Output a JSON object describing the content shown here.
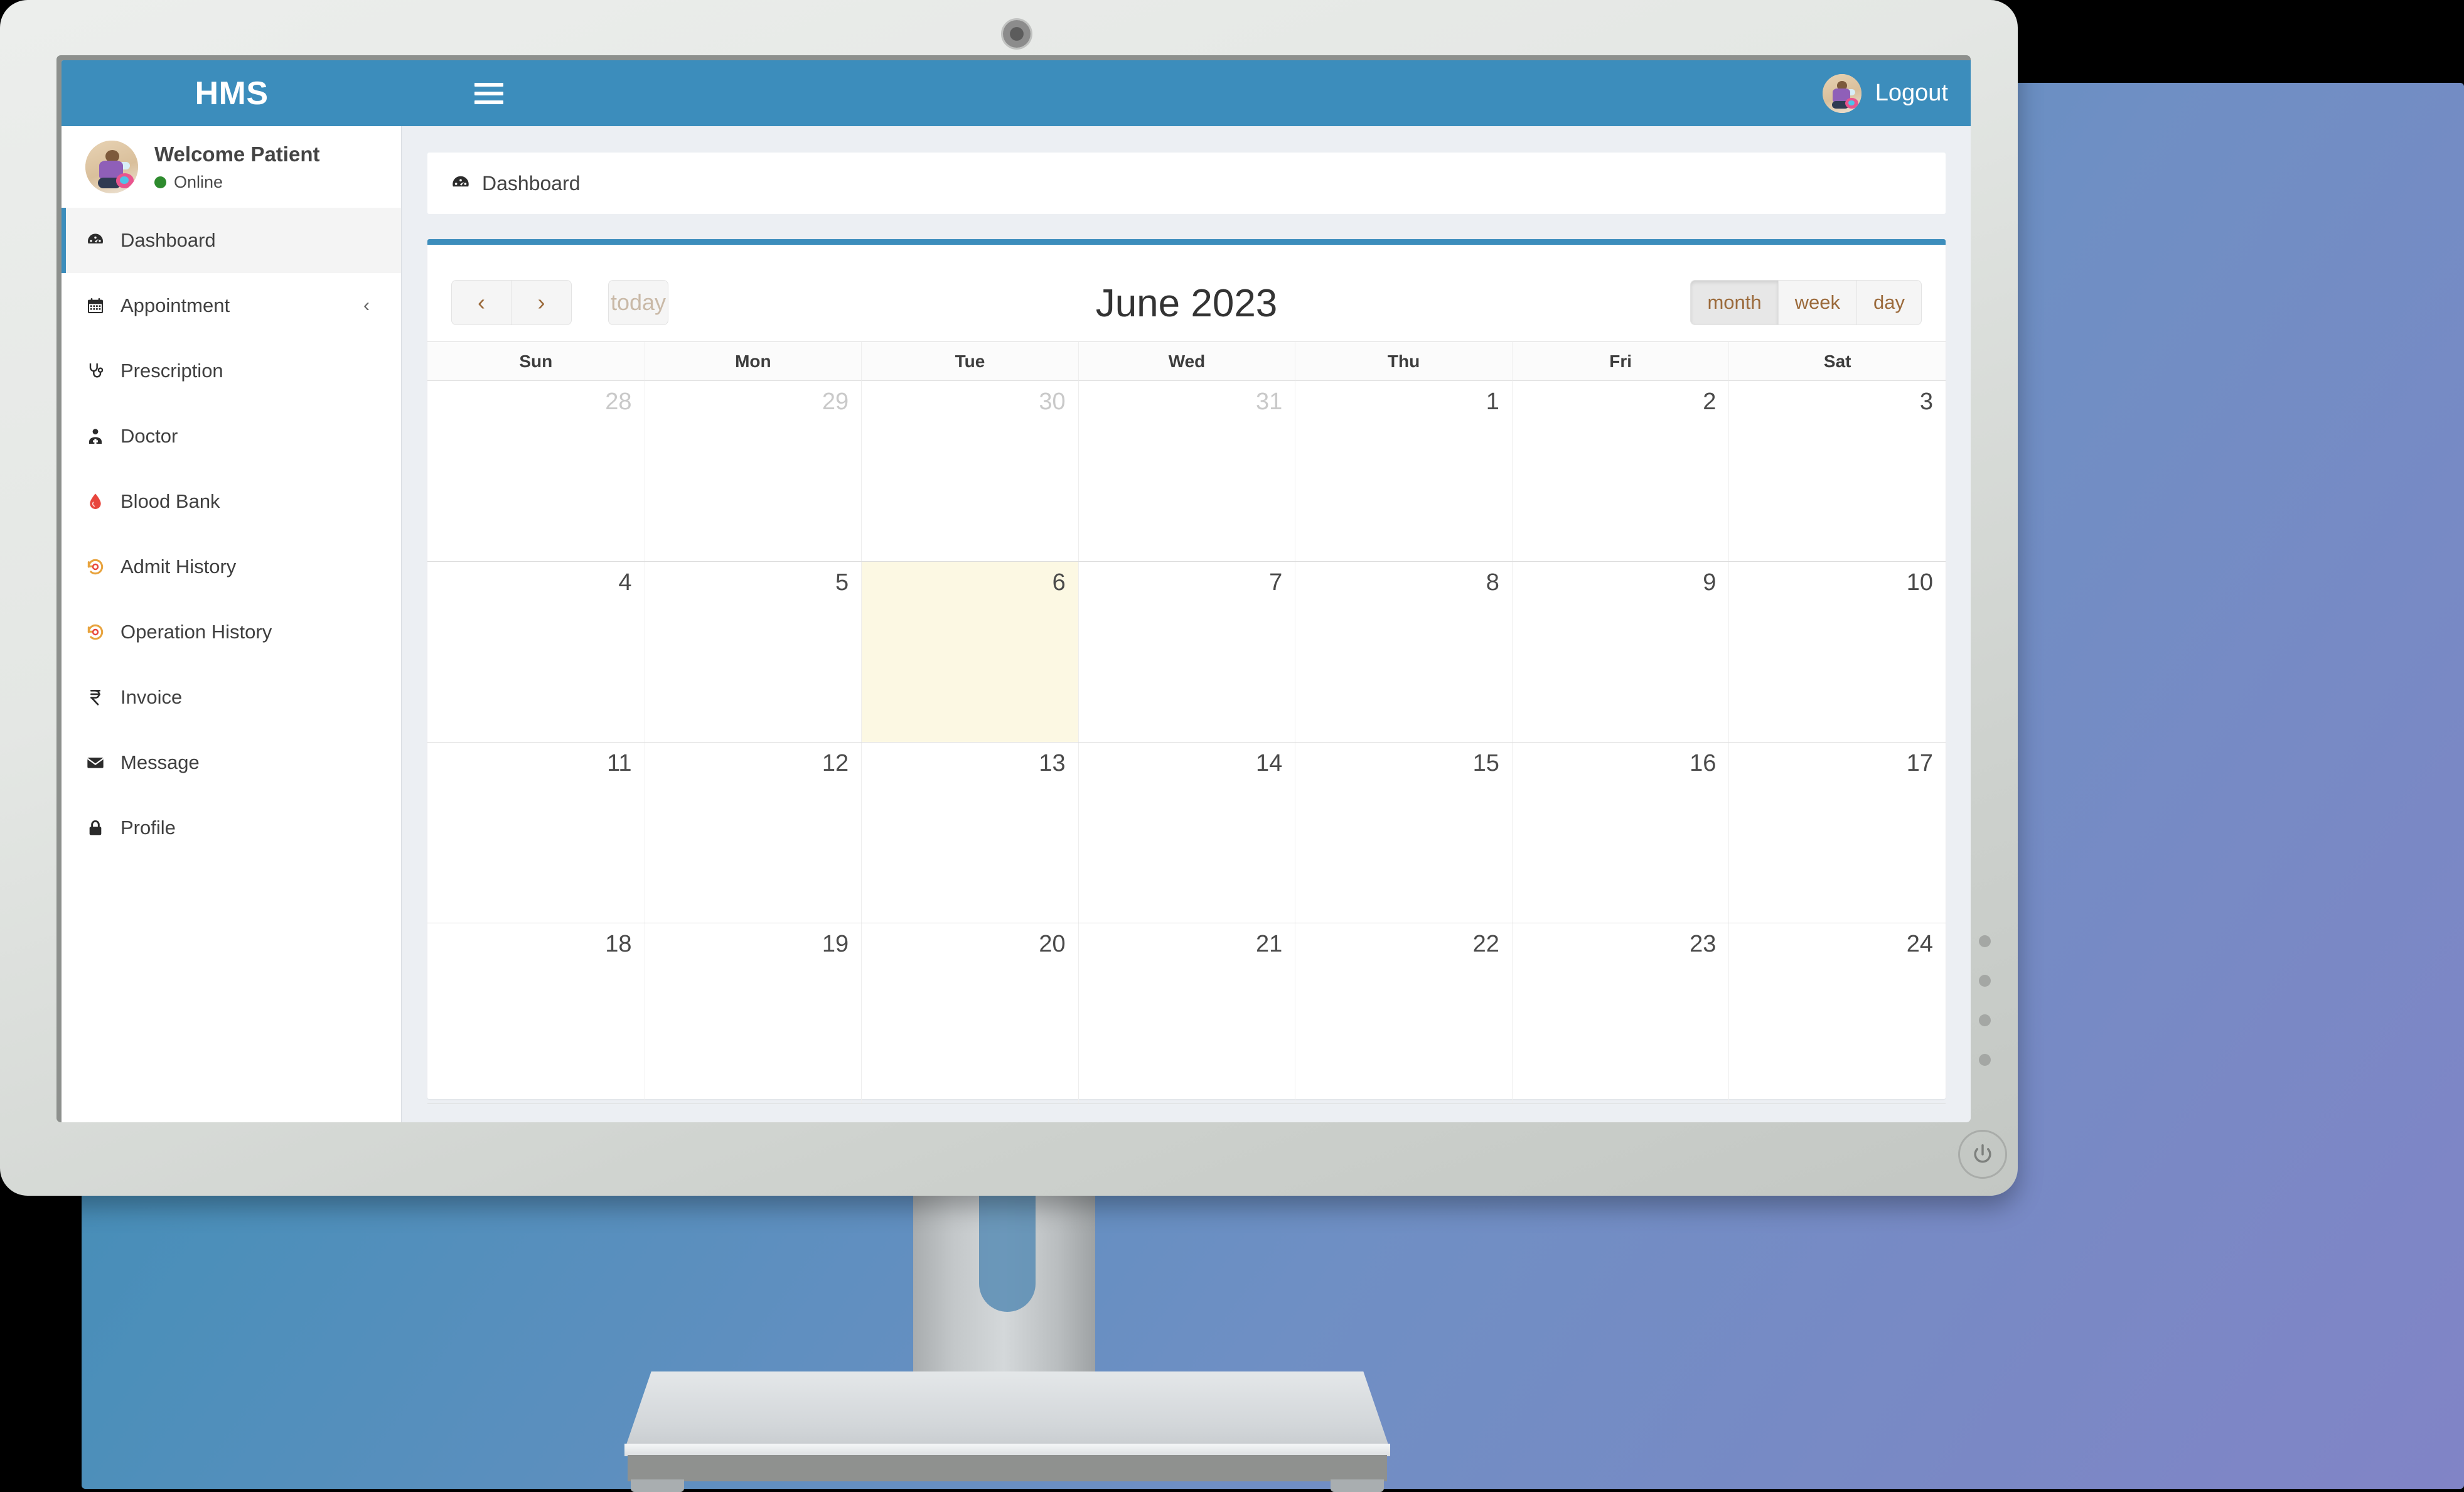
{
  "app": {
    "brand": "HMS",
    "menu_icon": "hamburger-icon",
    "logout_label": "Logout"
  },
  "user": {
    "name": "Welcome Patient",
    "status": "Online",
    "status_color": "#2e8b2e"
  },
  "sidebar": {
    "items": [
      {
        "label": "Dashboard",
        "icon": "dashboard-icon",
        "active": true,
        "caret": ""
      },
      {
        "label": "Appointment",
        "icon": "calendar-icon",
        "active": false,
        "caret": "‹"
      },
      {
        "label": "Prescription",
        "icon": "stethoscope-icon",
        "active": false,
        "caret": ""
      },
      {
        "label": "Doctor",
        "icon": "doctor-icon",
        "active": false,
        "caret": ""
      },
      {
        "label": "Blood Bank",
        "icon": "blood-drop-icon",
        "active": false,
        "caret": ""
      },
      {
        "label": "Admit History",
        "icon": "history-icon",
        "active": false,
        "caret": ""
      },
      {
        "label": "Operation History",
        "icon": "history-icon",
        "active": false,
        "caret": ""
      },
      {
        "label": "Invoice",
        "icon": "rupee-icon",
        "active": false,
        "caret": ""
      },
      {
        "label": "Message",
        "icon": "envelope-icon",
        "active": false,
        "caret": ""
      },
      {
        "label": "Profile",
        "icon": "lock-icon",
        "active": false,
        "caret": ""
      }
    ]
  },
  "breadcrumb": {
    "icon": "dashboard-icon",
    "label": "Dashboard"
  },
  "calendar": {
    "title": "June 2023",
    "prev_label": "‹",
    "next_label": "›",
    "today_label": "today",
    "today_disabled": true,
    "views": [
      {
        "label": "month",
        "active": true
      },
      {
        "label": "week",
        "active": false
      },
      {
        "label": "day",
        "active": false
      }
    ],
    "day_headers": [
      "Sun",
      "Mon",
      "Tue",
      "Wed",
      "Thu",
      "Fri",
      "Sat"
    ],
    "weeks": [
      [
        {
          "day": "28",
          "other": true,
          "today": false
        },
        {
          "day": "29",
          "other": true,
          "today": false
        },
        {
          "day": "30",
          "other": true,
          "today": false
        },
        {
          "day": "31",
          "other": true,
          "today": false
        },
        {
          "day": "1",
          "other": false,
          "today": false
        },
        {
          "day": "2",
          "other": false,
          "today": false
        },
        {
          "day": "3",
          "other": false,
          "today": false
        }
      ],
      [
        {
          "day": "4",
          "other": false,
          "today": false
        },
        {
          "day": "5",
          "other": false,
          "today": false
        },
        {
          "day": "6",
          "other": false,
          "today": true
        },
        {
          "day": "7",
          "other": false,
          "today": false
        },
        {
          "day": "8",
          "other": false,
          "today": false
        },
        {
          "day": "9",
          "other": false,
          "today": false
        },
        {
          "day": "10",
          "other": false,
          "today": false
        }
      ],
      [
        {
          "day": "11",
          "other": false,
          "today": false
        },
        {
          "day": "12",
          "other": false,
          "today": false
        },
        {
          "day": "13",
          "other": false,
          "today": false
        },
        {
          "day": "14",
          "other": false,
          "today": false
        },
        {
          "day": "15",
          "other": false,
          "today": false
        },
        {
          "day": "16",
          "other": false,
          "today": false
        },
        {
          "day": "17",
          "other": false,
          "today": false
        }
      ],
      [
        {
          "day": "18",
          "other": false,
          "today": false
        },
        {
          "day": "19",
          "other": false,
          "today": false
        },
        {
          "day": "20",
          "other": false,
          "today": false
        },
        {
          "day": "21",
          "other": false,
          "today": false
        },
        {
          "day": "22",
          "other": false,
          "today": false
        },
        {
          "day": "23",
          "other": false,
          "today": false
        },
        {
          "day": "24",
          "other": false,
          "today": false
        }
      ]
    ]
  },
  "monitor": {
    "webcam": "webcam-icon",
    "power_button": "power-icon",
    "bezel_dots": 4
  },
  "colors": {
    "brand_blue": "#3c8dbc",
    "today_highlight": "#fcf8e3",
    "online_green": "#2e8b2e",
    "page_bg": "#eceff3"
  }
}
